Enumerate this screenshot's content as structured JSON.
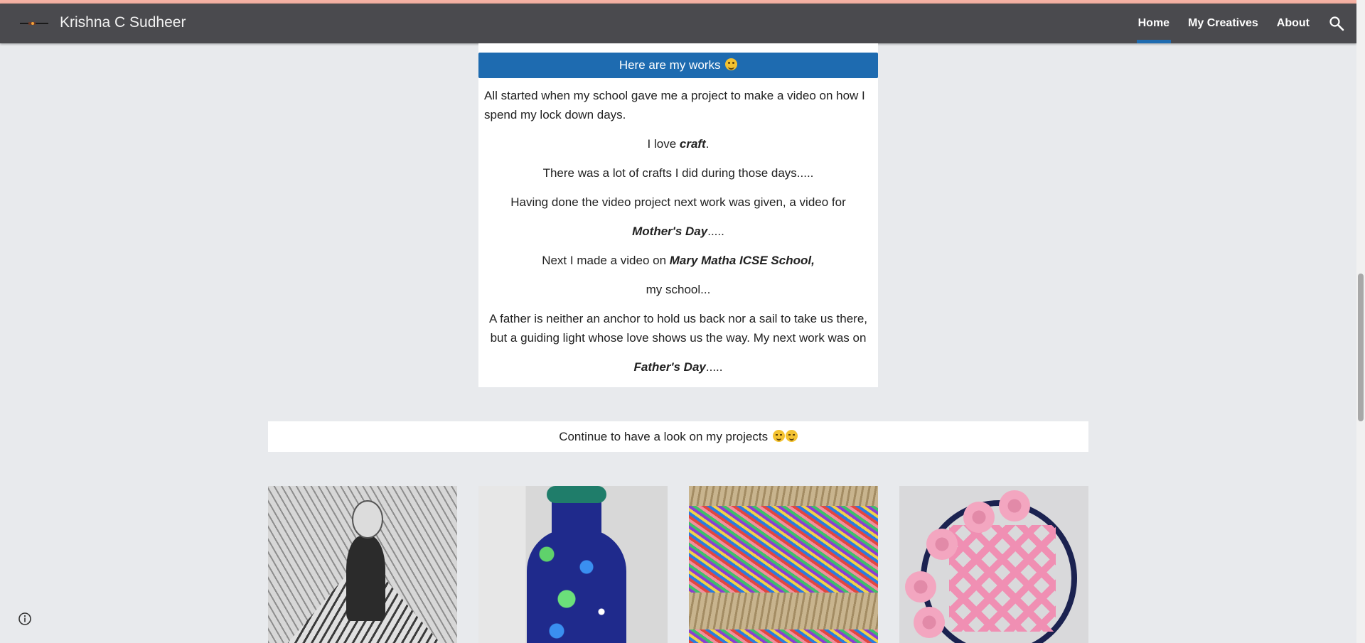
{
  "header": {
    "site_title": "Krishna C Sudheer",
    "nav": [
      {
        "label": "Home",
        "active": true
      },
      {
        "label": "My Creatives",
        "active": false
      },
      {
        "label": "About",
        "active": false
      }
    ],
    "search_icon": "search-icon",
    "accent_color": "#1e6bb0",
    "bar_color": "#4a4a4e"
  },
  "works": {
    "banner": "Here are my works",
    "p1": "All started when my school gave me a project to make a video on how I spend my lock down days.",
    "p2_pre": "I love ",
    "p2_em": "craft",
    "p2_post": ".",
    "p3": "There was a lot of crafts I did during those days.....",
    "p4": "Having done the video project next work was given, a video for",
    "p5_em": "Mother's Day",
    "p5_post": ".....",
    "p6_pre": "Next I made a video on ",
    "p6_em": "Mary Matha ICSE School,",
    "p7": "my school...",
    "p8": "A father is neither an anchor to hold us back nor a sail to take us there, but a guiding light whose love shows us the way. My next work was on",
    "p9_em": "Father's Day",
    "p9_post": "....."
  },
  "continue": {
    "text": "Continue to have a look on my projects"
  },
  "gallery": {
    "tiles": [
      "drawing-artwork-image",
      "painted-bottle-image",
      "rice-rope-craft-image",
      "paper-flower-frame-image"
    ]
  }
}
